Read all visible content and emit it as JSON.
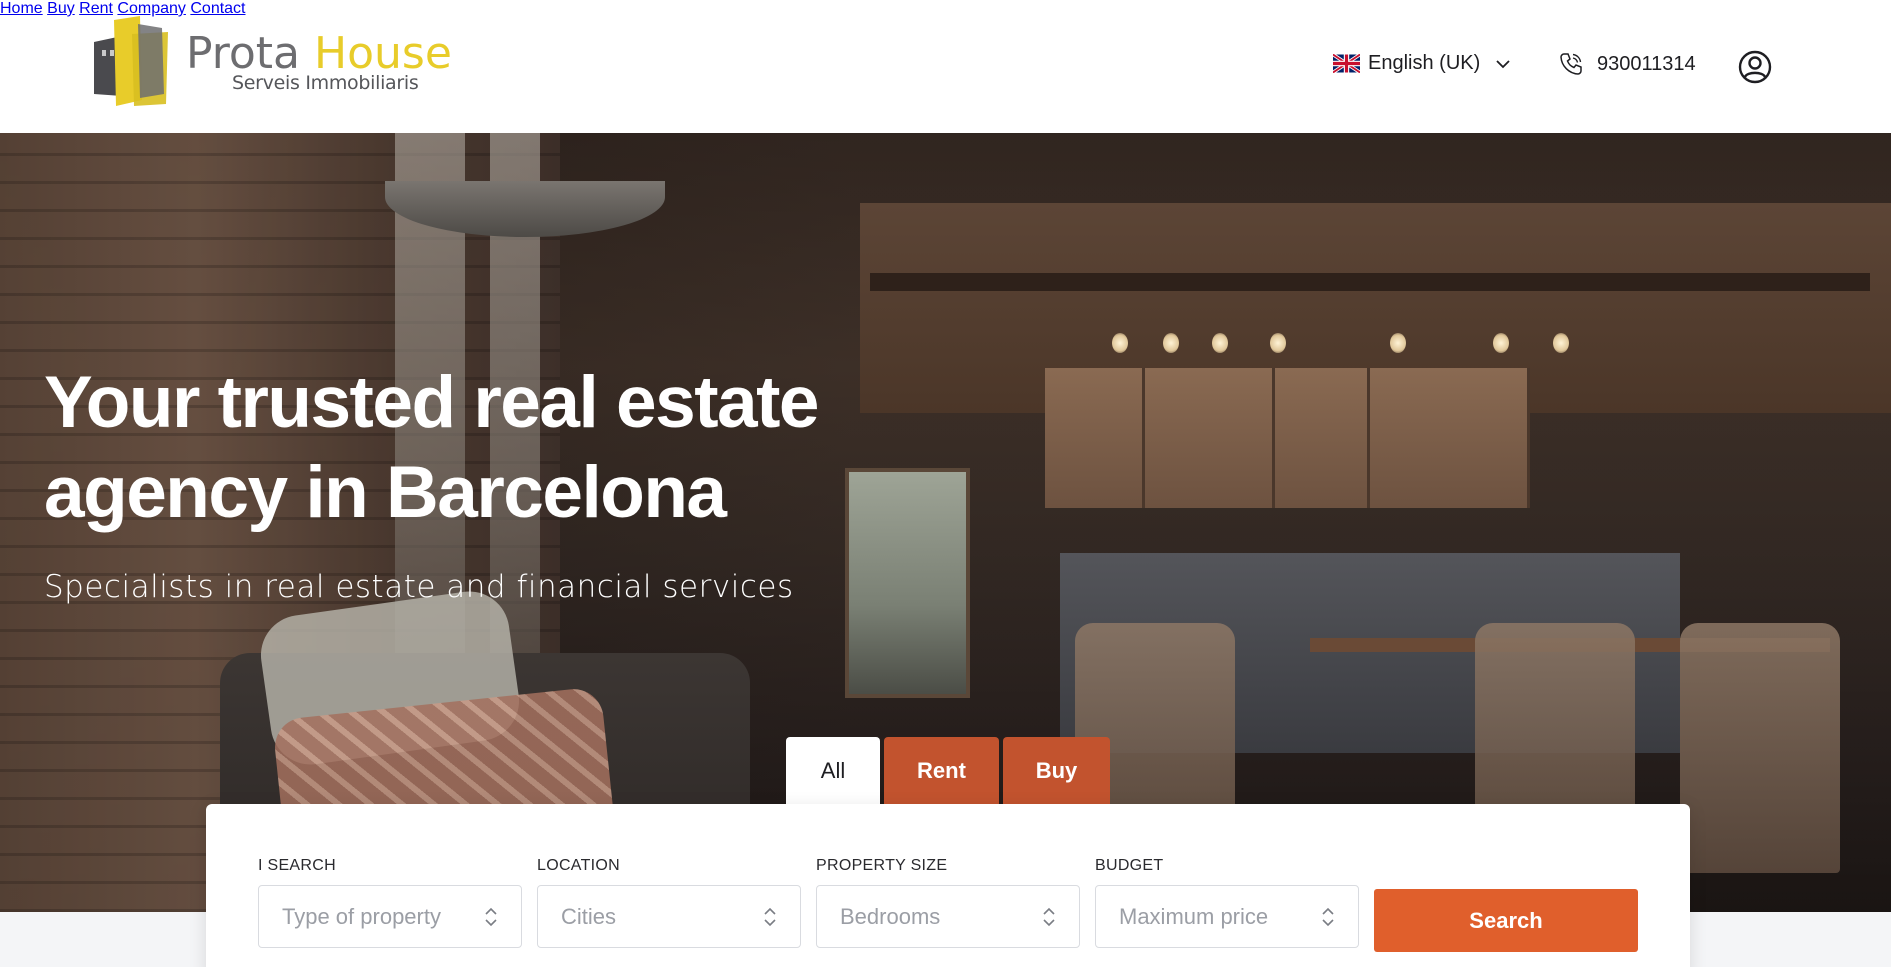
{
  "brand": {
    "name_part1": "Prota",
    "name_part2": "House",
    "tagline": "Serveis Immobiliaris",
    "color_primary": "#e8cc2a",
    "color_secondary": "#6d6d70"
  },
  "nav": {
    "items": [
      "Home",
      "Buy",
      "Rent",
      "Company",
      "Contact"
    ],
    "language": "English (UK)",
    "language_icon": "uk-flag-icon",
    "phone": "930011314",
    "phone_icon": "phone-icon",
    "account_icon": "user-icon"
  },
  "hero": {
    "title": "Your trusted real estate agency in Barcelona",
    "subtitle": "Specialists in real estate and financial services"
  },
  "search": {
    "tabs": [
      "All",
      "Rent",
      "Buy"
    ],
    "active_tab": "All",
    "fields": [
      {
        "label": "I SEARCH",
        "placeholder": "Type of property"
      },
      {
        "label": "LOCATION",
        "placeholder": "Cities"
      },
      {
        "label": "PROPERTY SIZE",
        "placeholder": "Bedrooms"
      },
      {
        "label": "BUDGET",
        "placeholder": "Maximum price"
      }
    ],
    "button_label": "Search",
    "accent_color": "#e05f2c"
  }
}
